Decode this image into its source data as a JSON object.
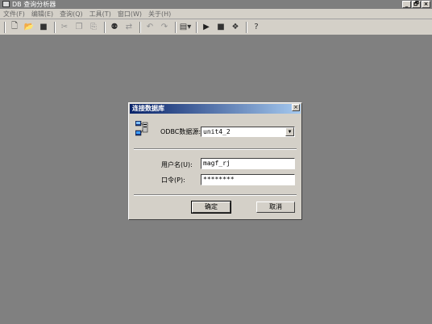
{
  "window": {
    "title": "DB 查询分析器",
    "controls": [
      "_",
      "🗗",
      "×"
    ]
  },
  "menu": [
    "文件(F)",
    "编辑(E)",
    "查询(Q)",
    "工具(T)",
    "窗口(W)",
    "关于(H)"
  ],
  "toolbar": {
    "icons": [
      "new-query-icon",
      "open-file-icon",
      "save-icon",
      "cut-icon",
      "copy-icon",
      "paste-icon",
      "find-icon",
      "replace-icon",
      "undo-icon",
      "redo-icon",
      "grid-mode-icon",
      "execute-icon",
      "stop-icon",
      "parse-icon",
      "help-icon"
    ]
  },
  "dialog": {
    "title": "连接数据库",
    "close": "×",
    "odbc_label": "ODBC数据源:",
    "odbc_value": "unit4_2",
    "user_label": "用户名(U):",
    "user_value": "magf_rj",
    "password_label": "口令(P):",
    "password_value": "********",
    "ok_label": "确定",
    "cancel_label": "取消"
  }
}
